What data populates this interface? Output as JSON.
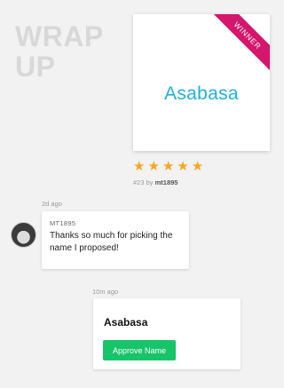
{
  "header": {
    "line1": "WRAP",
    "line2": "UP"
  },
  "winner": {
    "name": "Asabasa",
    "ribbon_label": "WINNER",
    "rating": 5,
    "rank": "#23",
    "by_label": "by",
    "user": "mt1895",
    "colors": {
      "accent": "#22b0d8",
      "ribbon": "#d4166d",
      "star": "#f6a623"
    }
  },
  "message": {
    "time": "2d ago",
    "user": "MT1895",
    "text": "Thanks so much for picking the name I proposed!"
  },
  "approval": {
    "time": "10m ago",
    "name": "Asabasa",
    "button_label": "Approve Name",
    "button_color": "#18c46a"
  },
  "icons": {
    "star": "star-icon",
    "avatar": "user-avatar"
  }
}
